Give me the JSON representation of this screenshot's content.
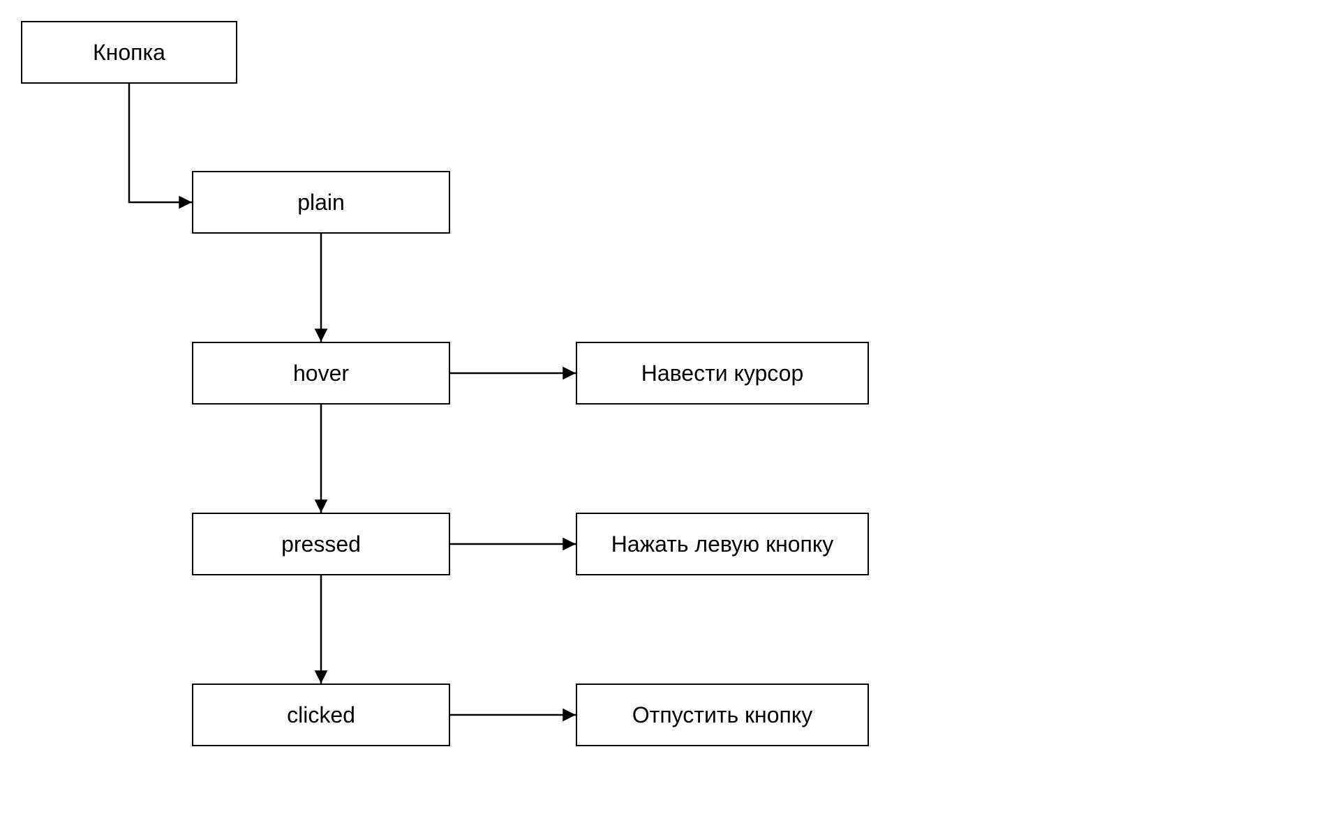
{
  "diagram": {
    "nodes": {
      "root": {
        "label": "Кнопка"
      },
      "plain": {
        "label": "plain"
      },
      "hover": {
        "label": "hover"
      },
      "pressed": {
        "label": "pressed"
      },
      "clicked": {
        "label": "clicked"
      },
      "hover_action": {
        "label": "Навести курсор"
      },
      "pressed_action": {
        "label": "Нажать левую кнопку"
      },
      "clicked_action": {
        "label": "Отпустить кнопку"
      }
    },
    "edges": [
      {
        "from": "root",
        "to": "plain",
        "kind": "elbow-right"
      },
      {
        "from": "plain",
        "to": "hover",
        "kind": "down"
      },
      {
        "from": "hover",
        "to": "pressed",
        "kind": "down"
      },
      {
        "from": "pressed",
        "to": "clicked",
        "kind": "down"
      },
      {
        "from": "hover",
        "to": "hover_action",
        "kind": "right"
      },
      {
        "from": "pressed",
        "to": "pressed_action",
        "kind": "right"
      },
      {
        "from": "clicked",
        "to": "clicked_action",
        "kind": "right"
      }
    ]
  }
}
